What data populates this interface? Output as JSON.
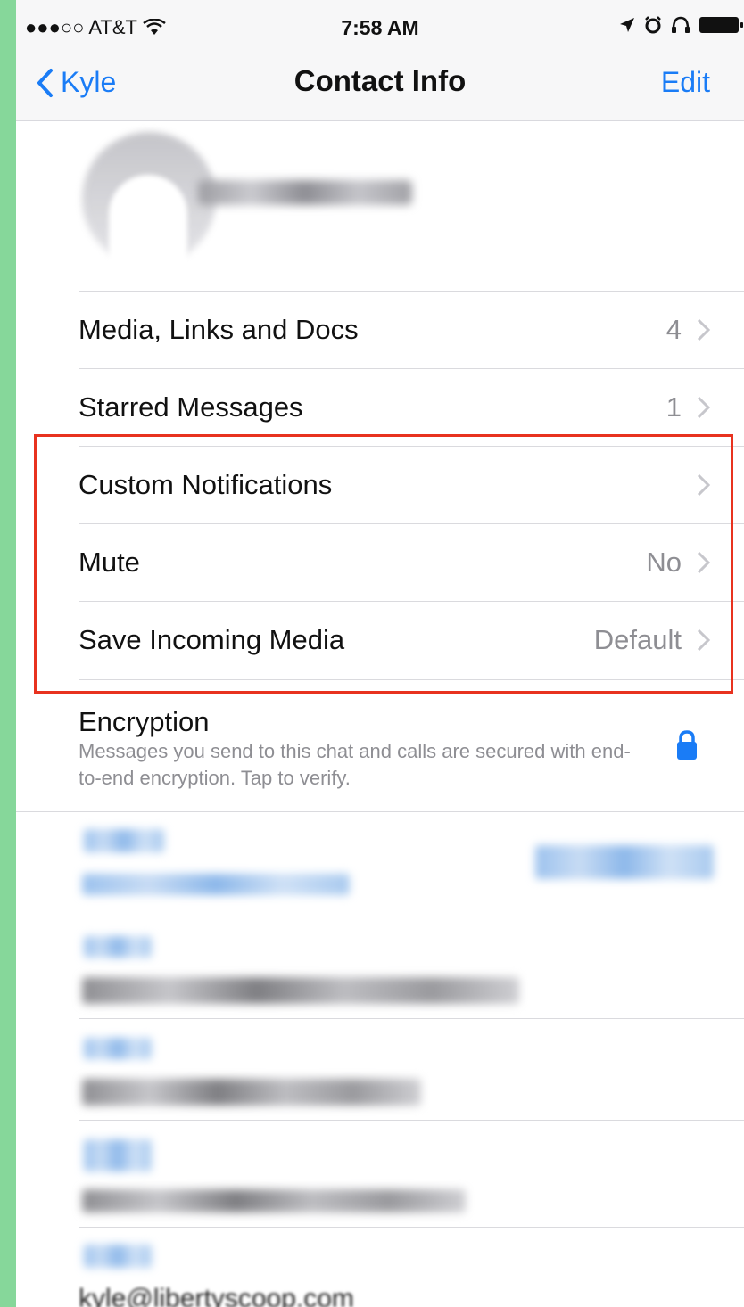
{
  "status_bar": {
    "carrier": "●●●○○ AT&T",
    "time": "7:58 AM"
  },
  "nav": {
    "back_label": "Kyle",
    "title": "Contact Info",
    "edit_label": "Edit"
  },
  "rows": [
    {
      "label": "Media, Links and Docs",
      "value": "4"
    },
    {
      "label": "Starred Messages",
      "value": "1"
    },
    {
      "label": "Custom Notifications",
      "value": ""
    },
    {
      "label": "Mute",
      "value": "No"
    },
    {
      "label": "Save Incoming Media",
      "value": "Default"
    }
  ],
  "encryption": {
    "title": "Encryption",
    "description": "Messages you send to this chat and calls are secured with end-to-end encryption. Tap to verify."
  },
  "footer": {
    "partial_text": "kyle@libertyscoop.com"
  },
  "colors": {
    "accent": "#1a7cf6",
    "highlight": "#e8321f",
    "background": "#86d79a"
  }
}
